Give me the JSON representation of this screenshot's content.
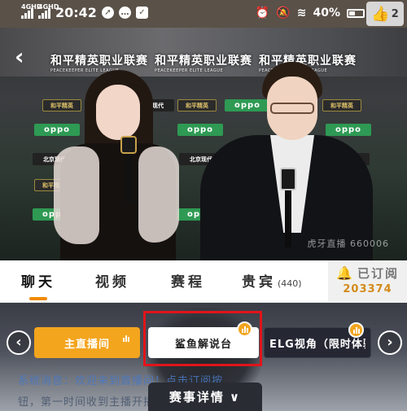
{
  "status_bar": {
    "network_1": "4GHD",
    "network_2": "4GHD",
    "time": "20:42",
    "battery": "40%",
    "like_count": "2"
  },
  "video": {
    "banner_text": "和平精英职业联赛",
    "banner_sub": "PEACEKEEPER ELITE LEAGUE",
    "sponsor_oppo": "oppo",
    "sponsor_hpjy": "和平精英",
    "sponsor_bj": "北京现代",
    "watermark": "虎牙直播 660006"
  },
  "tabs": [
    {
      "label": "聊天"
    },
    {
      "label": "视频"
    },
    {
      "label": "赛程"
    },
    {
      "label": "贵宾",
      "count": "(440)"
    }
  ],
  "subscribe": {
    "label": "已订阅",
    "count": "203374"
  },
  "channels": [
    {
      "label": "主直播间"
    },
    {
      "label": "鲨鱼解说台"
    },
    {
      "label": "ELG视角（限时体验）"
    }
  ],
  "chat": {
    "line1": "系统消息：欢迎来到直播间！点击订阅按",
    "line2": "钮，第一时间收到主播开播通知，祝您玩得开心！"
  },
  "detail_tab": {
    "label": "赛事详情"
  },
  "colors": {
    "accent": "#f3a51e",
    "highlight": "#e0141a",
    "subscribe_count": "#d48a1a"
  }
}
